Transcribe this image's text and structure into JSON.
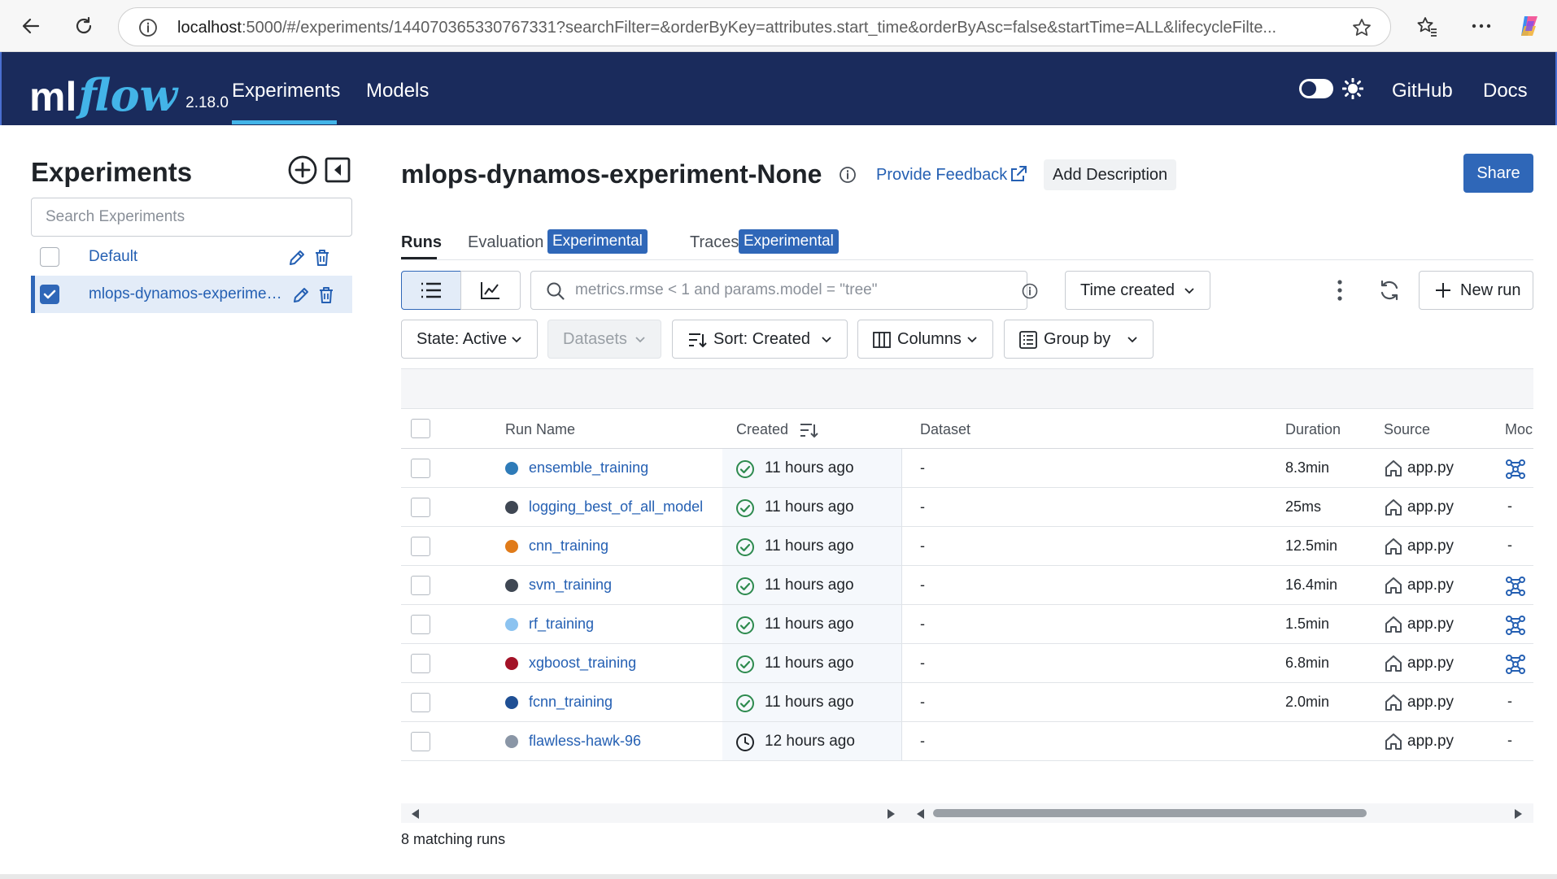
{
  "browser": {
    "url_host": "localhost",
    "url_rest": ":5000/#/experiments/144070365330767331?searchFilter=&orderByKey=attributes.start_time&orderByAsc=false&startTime=ALL&lifecycleFilte..."
  },
  "header": {
    "logo_ml": "ml",
    "logo_flow": "flow",
    "version": "2.18.0",
    "nav": [
      "Experiments",
      "Models"
    ],
    "github": "GitHub",
    "docs": "Docs"
  },
  "sidebar": {
    "title": "Experiments",
    "search_placeholder": "Search Experiments",
    "experiments": [
      {
        "name": "Default",
        "selected": false
      },
      {
        "name": "mlops-dynamos-experiment-None",
        "selected": true
      }
    ]
  },
  "main": {
    "title": "mlops-dynamos-experiment-None",
    "feedback": "Provide Feedback",
    "add_description": "Add Description",
    "share": "Share",
    "tabs": [
      {
        "label": "Runs"
      },
      {
        "label": "Evaluation",
        "badge": "Experimental"
      },
      {
        "label": "Traces",
        "badge": "Experimental"
      }
    ],
    "filter_placeholder": "metrics.rmse < 1 and params.model = \"tree\"",
    "time_created": "Time created",
    "new_run": "New run",
    "state": "State: Active",
    "datasets": "Datasets",
    "sort": "Sort: Created",
    "columns": "Columns",
    "group_by": "Group by"
  },
  "table": {
    "headers": [
      "Run Name",
      "Created",
      "Dataset",
      "Duration",
      "Source",
      "Moc"
    ],
    "rows": [
      {
        "name": "ensemble_training",
        "color": "#2e7bb8",
        "status": "finished",
        "created": "11 hours ago",
        "dataset": "-",
        "duration": "8.3min",
        "source": "app.py",
        "model": "model-icon"
      },
      {
        "name": "logging_best_of_all_model",
        "color": "#3f4753",
        "status": "finished",
        "created": "11 hours ago",
        "dataset": "-",
        "duration": "25ms",
        "source": "app.py",
        "model": "-"
      },
      {
        "name": "cnn_training",
        "color": "#e07b1a",
        "status": "finished",
        "created": "11 hours ago",
        "dataset": "-",
        "duration": "12.5min",
        "source": "app.py",
        "model": "-"
      },
      {
        "name": "svm_training",
        "color": "#3f4753",
        "status": "finished",
        "created": "11 hours ago",
        "dataset": "-",
        "duration": "16.4min",
        "source": "app.py",
        "model": "model-icon"
      },
      {
        "name": "rf_training",
        "color": "#8cc3f0",
        "status": "finished",
        "created": "11 hours ago",
        "dataset": "-",
        "duration": "1.5min",
        "source": "app.py",
        "model": "model-icon"
      },
      {
        "name": "xgboost_training",
        "color": "#a31227",
        "status": "finished",
        "created": "11 hours ago",
        "dataset": "-",
        "duration": "6.8min",
        "source": "app.py",
        "model": "model-icon"
      },
      {
        "name": "fcnn_training",
        "color": "#1f4f94",
        "status": "finished",
        "created": "11 hours ago",
        "dataset": "-",
        "duration": "2.0min",
        "source": "app.py",
        "model": "-"
      },
      {
        "name": "flawless-hawk-96",
        "color": "#8a96a6",
        "status": "running",
        "created": "12 hours ago",
        "dataset": "-",
        "duration": "",
        "source": "app.py",
        "model": "-"
      }
    ]
  },
  "footer": {
    "count": "8 matching runs"
  },
  "colors": {
    "header_bg": "#1a2b5c",
    "accent": "#2f67b8",
    "link": "#2560b3",
    "logo_flow": "#43b4e8"
  }
}
